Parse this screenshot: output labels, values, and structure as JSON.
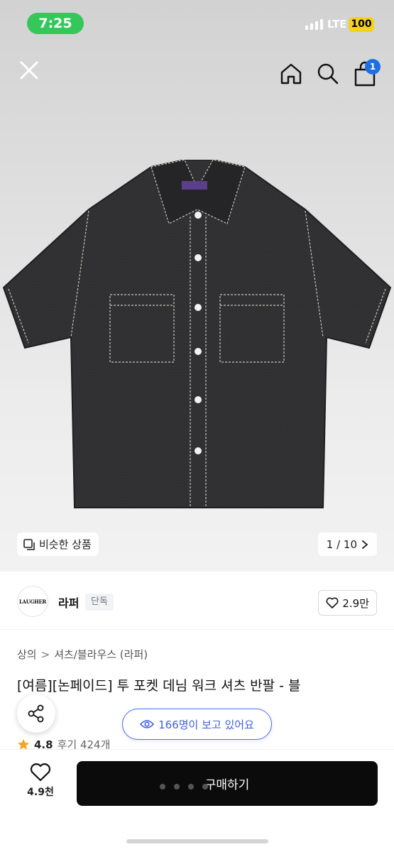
{
  "status_bar": {
    "time": "7:25",
    "network": "LTE",
    "battery": "100"
  },
  "top_nav": {
    "cart_badge": "1"
  },
  "hero": {
    "similar_label": "비슷한 상품",
    "counter": "1 / 10"
  },
  "brand": {
    "logo_text": "LAUGHER",
    "name": "라퍼",
    "tag": "단독",
    "likes": "2.9만"
  },
  "breadcrumb": [
    "상의",
    "셔츠/블라우스 (라퍼)"
  ],
  "product": {
    "title": "[여름][논페이드] 투 포켓 데님 워크 셔츠 반팔 - 블"
  },
  "rating": {
    "score": "4.8",
    "reviews": "후기 424개"
  },
  "viewers": "166명이 보고 있어요",
  "bottom": {
    "wish_count": "4.9천",
    "buy_label": "구매하기"
  },
  "colors": {
    "accent": "#3d5ee6",
    "badge": "#1e6fe6",
    "status_green": "#34c759",
    "battery": "#f5d21a",
    "buy_bg": "#0b0b0b"
  },
  "icons": [
    "close-icon",
    "home-icon",
    "search-icon",
    "cart-icon",
    "similar-icon",
    "chevron-right-icon",
    "heart-icon",
    "share-icon",
    "eye-icon",
    "star-icon"
  ]
}
